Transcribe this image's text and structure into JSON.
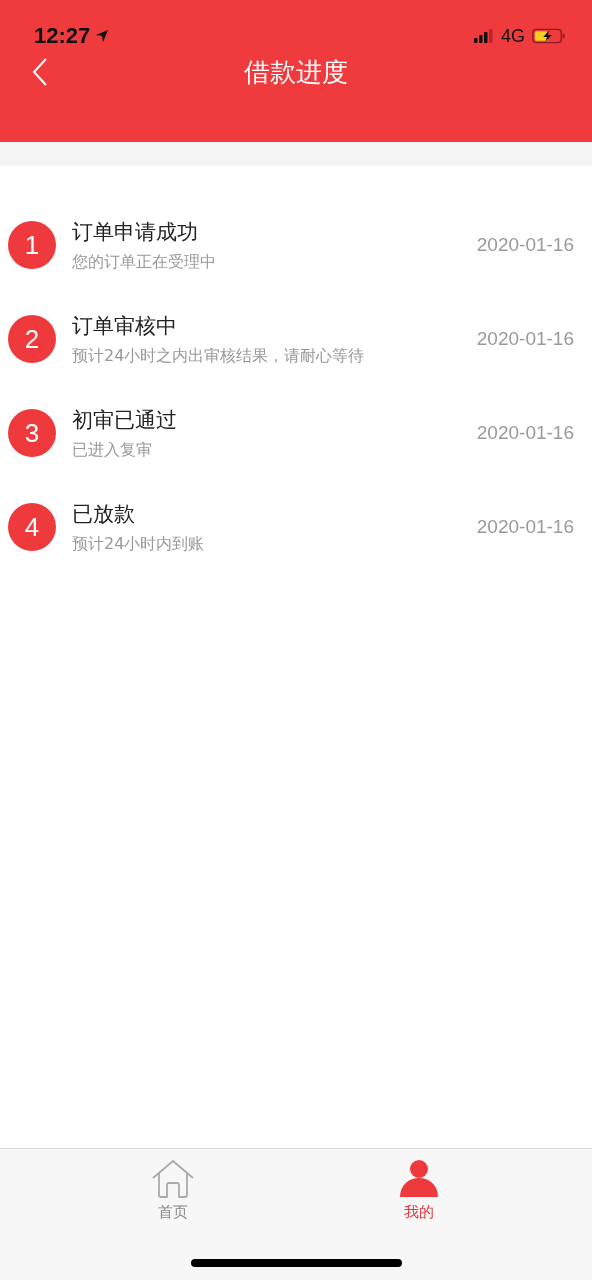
{
  "status_bar": {
    "time": "12:27",
    "network": "4G"
  },
  "nav_bar": {
    "title": "借款进度"
  },
  "steps": [
    {
      "number": "1",
      "title": "订单申请成功",
      "subtitle": "您的订单正在受理中",
      "date": "2020-01-16"
    },
    {
      "number": "2",
      "title": "订单审核中",
      "subtitle": "预计24小时之内出审核结果，请耐心等待",
      "date": "2020-01-16"
    },
    {
      "number": "3",
      "title": "初审已通过",
      "subtitle": "已进入复审",
      "date": "2020-01-16"
    },
    {
      "number": "4",
      "title": "已放款",
      "subtitle": "预计24小时内到账",
      "date": "2020-01-16"
    }
  ],
  "tab_bar": [
    {
      "label": "首页",
      "kind": "home",
      "selected": false
    },
    {
      "label": "我的",
      "kind": "profile",
      "selected": true
    }
  ]
}
